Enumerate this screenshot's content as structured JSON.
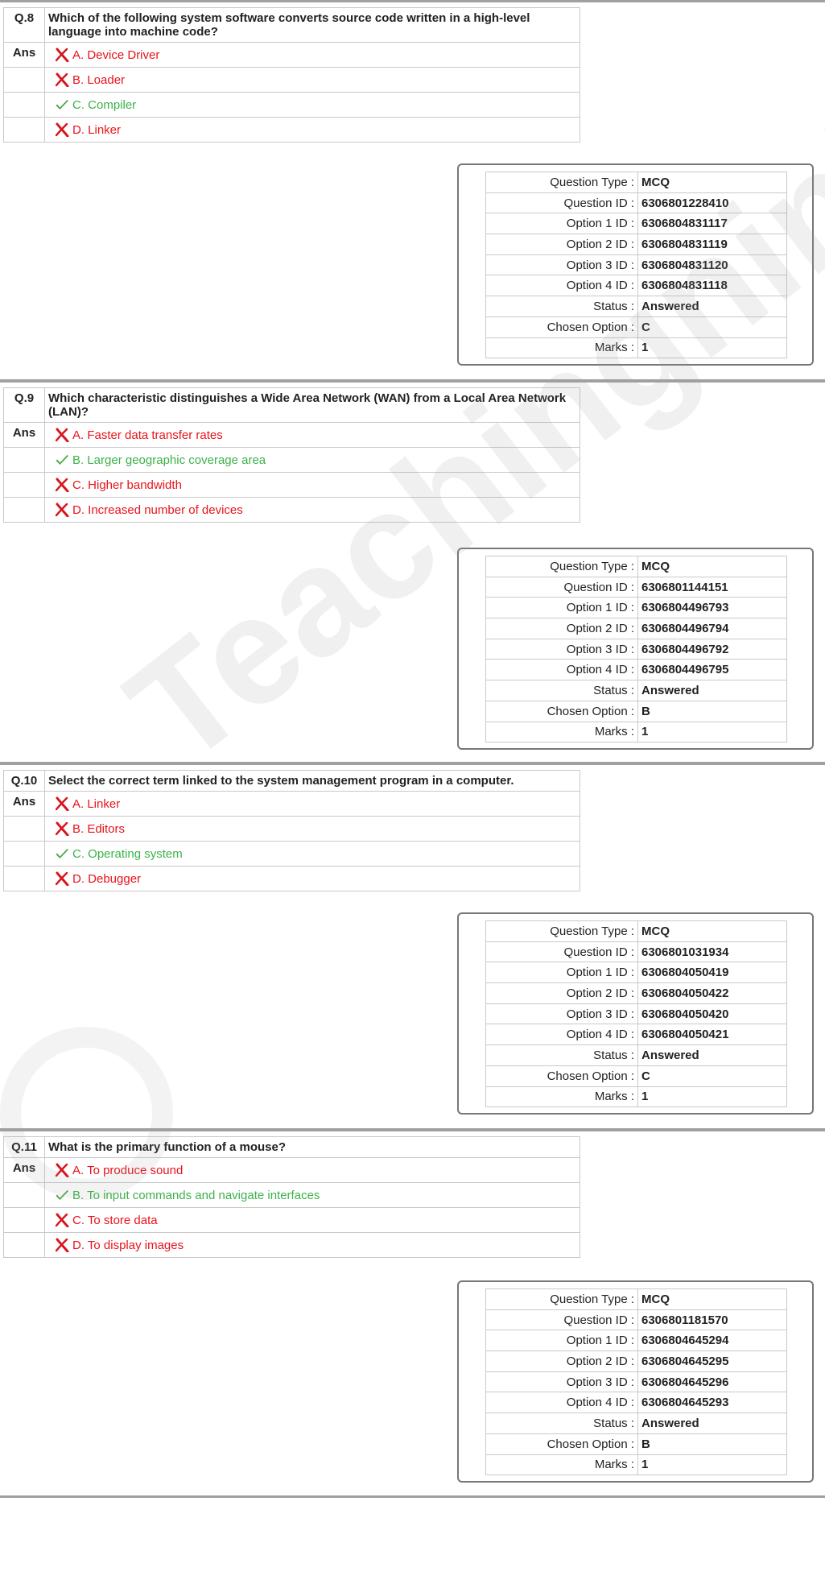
{
  "watermark": "Teachingninja.in",
  "ans_label": "Ans",
  "info_labels": {
    "question_type": "Question Type :",
    "question_id": "Question ID :",
    "option1_id": "Option 1 ID :",
    "option2_id": "Option 2 ID :",
    "option3_id": "Option 3 ID :",
    "option4_id": "Option 4 ID :",
    "status": "Status :",
    "chosen_option": "Chosen Option :",
    "marks": "Marks :"
  },
  "questions": [
    {
      "number": "Q.8",
      "text": "Which of the following system software converts source code written in a high-level language into machine code?",
      "options": [
        {
          "text": "A. Device Driver",
          "correct": false
        },
        {
          "text": "B. Loader",
          "correct": false
        },
        {
          "text": "C. Compiler",
          "correct": true
        },
        {
          "text": "D. Linker",
          "correct": false
        }
      ],
      "info": {
        "question_type": "MCQ",
        "question_id": "6306801228410",
        "option1_id": "6306804831117",
        "option2_id": "6306804831119",
        "option3_id": "6306804831120",
        "option4_id": "6306804831118",
        "status": "Answered",
        "chosen_option": "C",
        "marks": "1"
      }
    },
    {
      "number": "Q.9",
      "text": "Which characteristic distinguishes a Wide Area Network (WAN) from a Local Area Network (LAN)?",
      "options": [
        {
          "text": "A. Faster data transfer rates",
          "correct": false
        },
        {
          "text": "B. Larger geographic coverage area",
          "correct": true
        },
        {
          "text": "C. Higher bandwidth",
          "correct": false
        },
        {
          "text": "D. Increased number of devices",
          "correct": false
        }
      ],
      "info": {
        "question_type": "MCQ",
        "question_id": "6306801144151",
        "option1_id": "6306804496793",
        "option2_id": "6306804496794",
        "option3_id": "6306804496792",
        "option4_id": "6306804496795",
        "status": "Answered",
        "chosen_option": "B",
        "marks": "1"
      }
    },
    {
      "number": "Q.10",
      "text": "Select the correct term linked to the system management program in a computer.",
      "options": [
        {
          "text": "A. Linker",
          "correct": false
        },
        {
          "text": "B. Editors",
          "correct": false
        },
        {
          "text": "C. Operating system",
          "correct": true
        },
        {
          "text": "D. Debugger",
          "correct": false
        }
      ],
      "info": {
        "question_type": "MCQ",
        "question_id": "6306801031934",
        "option1_id": "6306804050419",
        "option2_id": "6306804050422",
        "option3_id": "6306804050420",
        "option4_id": "6306804050421",
        "status": "Answered",
        "chosen_option": "C",
        "marks": "1"
      }
    },
    {
      "number": "Q.11",
      "text": "What is the primary function of a mouse?",
      "options": [
        {
          "text": "A. To produce sound",
          "correct": false
        },
        {
          "text": "B. To input commands and navigate interfaces",
          "correct": true
        },
        {
          "text": "C. To store data",
          "correct": false
        },
        {
          "text": "D. To display images",
          "correct": false
        }
      ],
      "info": {
        "question_type": "MCQ",
        "question_id": "6306801181570",
        "option1_id": "6306804645294",
        "option2_id": "6306804645295",
        "option3_id": "6306804645296",
        "option4_id": "6306804645293",
        "status": "Answered",
        "chosen_option": "B",
        "marks": "1"
      }
    }
  ]
}
